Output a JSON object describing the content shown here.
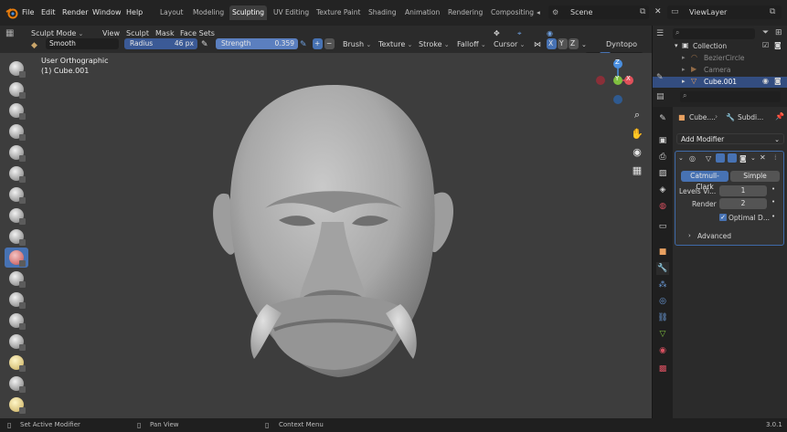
{
  "topbar": {
    "menus": [
      "File",
      "Edit",
      "Render",
      "Window",
      "Help"
    ],
    "workspaces": [
      "Layout",
      "Modeling",
      "Sculpting",
      "UV Editing",
      "Texture Paint",
      "Shading",
      "Animation",
      "Rendering",
      "Compositing"
    ],
    "active_workspace": "Sculpting",
    "scene": "Scene",
    "view_layer": "ViewLayer"
  },
  "toolbar": {
    "mode": "Sculpt Mode",
    "menus": [
      "View",
      "Sculpt",
      "Mask",
      "Face Sets"
    ],
    "brush_name": "Smooth",
    "radius_label": "Radius",
    "radius_value": "46 px",
    "strength_label": "Strength",
    "strength_value": "0.359",
    "plus": "+",
    "minus": "−",
    "dropdowns": [
      "Brush",
      "Texture",
      "Stroke",
      "Falloff",
      "Cursor"
    ],
    "axes": [
      "X",
      "Y",
      "Z"
    ],
    "dyntopo": "Dyntopo"
  },
  "viewport": {
    "view_name": "User Orthographic",
    "object_name": "(1) Cube.001",
    "gizmo": {
      "x": "X",
      "y": "Y",
      "z": "Z"
    }
  },
  "outliner": {
    "search_placeholder": "",
    "items": [
      {
        "label": "Collection"
      },
      {
        "label": "BezierCircle"
      },
      {
        "label": "Camera"
      },
      {
        "label": "Cube.001"
      }
    ]
  },
  "properties": {
    "breadcrumb_object": "Cube....",
    "breadcrumb_modifier": "Subdi...",
    "add_modifier": "Add Modifier",
    "catmull": "Catmull-Clark",
    "simple": "Simple",
    "levels_label": "Levels Vi...",
    "levels_value": "1",
    "render_label": "Render",
    "render_value": "2",
    "optimal": "Optimal D...",
    "advanced": "Advanced"
  },
  "statusbar": {
    "left": "Set Active Modifier",
    "mid": "Pan View",
    "right": "Context Menu",
    "version": "3.0.1"
  },
  "colors": {
    "accent": "#4772b3",
    "viewport_bg": "#3d3d3d",
    "gizmo_x": "#e0505a",
    "gizmo_y": "#7fbf3f",
    "gizmo_z": "#4a8fe0"
  }
}
